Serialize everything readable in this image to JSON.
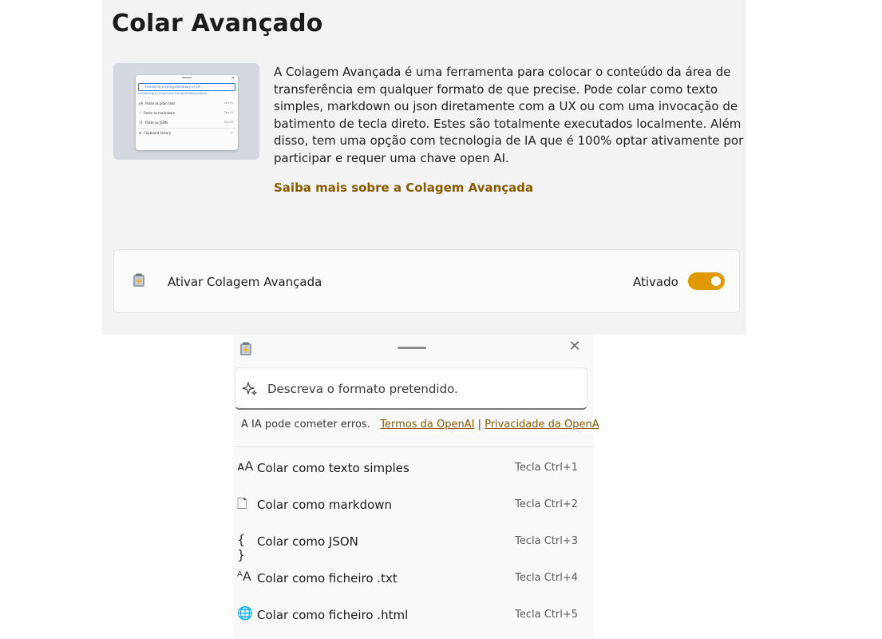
{
  "page_title": "Colar Avançado",
  "description": "A Colagem Avançada é uma ferramenta para colocar o conteúdo da área de transferência em qualquer formato de que precise. Pode colar como texto simples, markdown ou json diretamente com a UX ou com uma invocação de batimento de tecla direto. Estes são totalmente executados localmente. Além disso, tem uma opção com tecnologia de IA que é 100% optar ativamente por participar e requer uma chave open AI.",
  "learn_more": "Saiba mais sobre a Colagem Avançada",
  "hero_preview": {
    "input_placeholder": "Format to a string dictionary in CA",
    "status": "Connecting to AI services and generating output...",
    "items": [
      {
        "label": "Paste as plain text",
        "key": "Ctrl+1"
      },
      {
        "label": "Paste as markdown",
        "key": "Ctrl+2"
      },
      {
        "label": "Paste as JSON",
        "key": "Ctrl+3"
      },
      {
        "label": "Clipboard history",
        "key": ">"
      }
    ]
  },
  "enable_card": {
    "label": "Ativar Colagem Avançada",
    "state_text": "Ativado",
    "enabled": true
  },
  "popup": {
    "input_placeholder": "Descreva o formato pretendido.",
    "disclaimer": "A IA pode cometer erros.",
    "terms_link": "Termos da OpenAI",
    "separator": "|",
    "privacy_link": "Privacidade da OpenA",
    "options": [
      {
        "icon": "font-size-icon",
        "glyph": "ᴀA",
        "label": "Colar como texto simples",
        "shortcut": "Tecla Ctrl+1"
      },
      {
        "icon": "document-icon",
        "glyph": "🗋",
        "label": "Colar como markdown",
        "shortcut": "Tecla Ctrl+2"
      },
      {
        "icon": "braces-icon",
        "glyph": "{ }",
        "label": "Colar como JSON",
        "shortcut": "Tecla Ctrl+3"
      },
      {
        "icon": "text-file-icon",
        "glyph": "ᴬA",
        "label": "Colar como ficheiro .txt",
        "shortcut": "Tecla Ctrl+4"
      },
      {
        "icon": "globe-icon",
        "glyph": "🌐",
        "label": "Colar como ficheiro .html",
        "shortcut": "Tecla Ctrl+5"
      }
    ]
  },
  "colors": {
    "accent": "#e09a00",
    "link": "#8a5b00"
  }
}
